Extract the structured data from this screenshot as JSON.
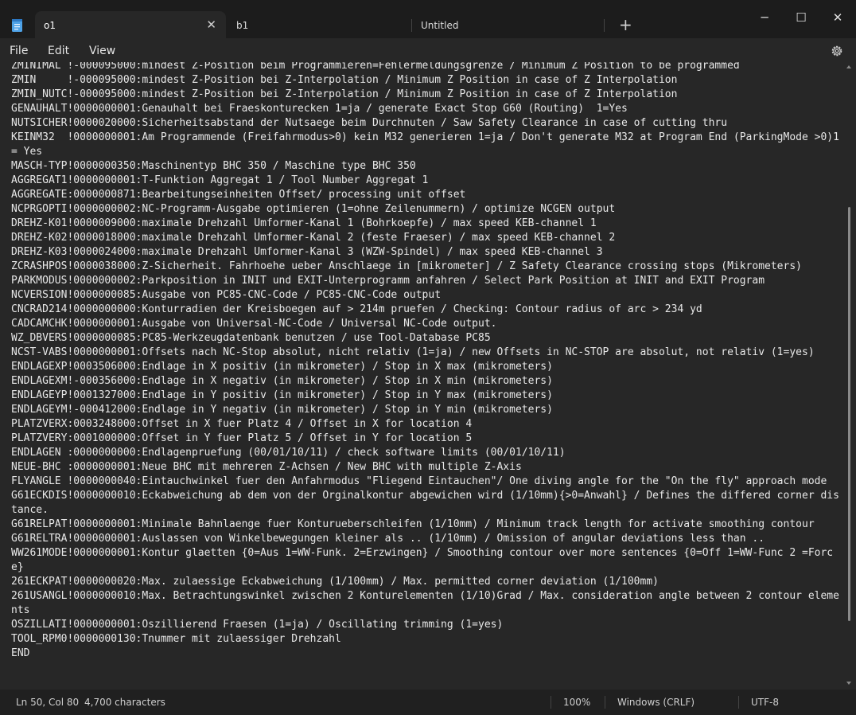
{
  "tabs": [
    {
      "label": "o1",
      "close": "✕"
    },
    {
      "label": "b1"
    },
    {
      "label": "Untitled"
    }
  ],
  "new_tab": "+",
  "window": {
    "minimize": "─",
    "maximize": "☐",
    "close": "✕"
  },
  "menu": {
    "file": "File",
    "edit": "Edit",
    "view": "View"
  },
  "lines": [
    "ZMINIMAL !-000095000:mindest Z-Position beim Programmieren=Fehlermeldungsgrenze / Minimum Z Position to be programmed",
    "ZMIN     !-000095000:mindest Z-Position bei Z-Interpolation / Minimum Z Position in case of Z Interpolation",
    "ZMIN_NUTC!-000095000:mindest Z-Position bei Z-Interpolation / Minimum Z Position in case of Z Interpolation",
    "GENAUHALT!0000000001:Genauhalt bei Fraeskonturecken 1=ja / generate Exact Stop G60 (Routing)  1=Yes",
    "NUTSICHER!0000020000:Sicherheitsabstand der Nutsaege beim Durchnuten / Saw Safety Clearance in case of cutting thru",
    "KEINM32  !0000000001:Am Programmende (Freifahrmodus>0) kein M32 generieren 1=ja / Don't generate M32 at Program End (ParkingMode >0)1= Yes",
    "MASCH-TYP!0000000350:Maschinentyp BHC 350 / Maschine type BHC 350",
    "AGGREGAT1!0000000001:T-Funktion Aggregat 1 / Tool Number Aggregat 1",
    "AGGREGATE:0000000871:Bearbeitungseinheiten Offset/ processing unit offset",
    "NCPRGOPTI!0000000002:NC-Programm-Ausgabe optimieren (1=ohne Zeilenummern) / optimize NCGEN output",
    "DREHZ-K01!0000009000:maximale Drehzahl Umformer-Kanal 1 (Bohrkoepfe) / max speed KEB-channel 1",
    "DREHZ-K02!0000018000:maximale Drehzahl Umformer-Kanal 2 (feste Fraeser) / max speed KEB-channel 2",
    "DREHZ-K03!0000024000:maximale Drehzahl Umformer-Kanal 3 (WZW-Spindel) / max speed KEB-channel 3",
    "ZCRASHPOS!0000038000:Z-Sicherheit. Fahrhoehe ueber Anschlaege in [mikrometer] / Z Safety Clearance crossing stops (Mikrometers)",
    "PARKMODUS!0000000002:Parkposition in INIT und EXIT-Unterprogramm anfahren / Select Park Position at INIT and EXIT Program",
    "NCVERSION!0000000085:Ausgabe von PC85-CNC-Code / PC85-CNC-Code output",
    "CNCRAD214!0000000000:Konturradien der Kreisboegen auf > 214m pruefen / Checking: Contour radius of arc > 234 yd",
    "CADCAMCHK!0000000001:Ausgabe von Universal-NC-Code / Universal NC-Code output.",
    "WZ_DBVERS!0000000085:PC85-Werkzeugdatenbank benutzen / use Tool-Database PC85",
    "NCST-VABS!0000000001:Offsets nach NC-Stop absolut, nicht relativ (1=ja) / new Offsets in NC-STOP are absolut, not relativ (1=yes)",
    "ENDLAGEXP!0003506000:Endlage in X positiv (in mikrometer) / Stop in X max (mikrometers)",
    "ENDLAGEXM!-000356000:Endlage in X negativ (in mikrometer) / Stop in X min (mikrometers)",
    "ENDLAGEYP!0001327000:Endlage in Y positiv (in mikrometer) / Stop in Y max (mikrometers)",
    "ENDLAGEYM!-000412000:Endlage in Y negativ (in mikrometer) / Stop in Y min (mikrometers)",
    "PLATZVERX:0003248000:Offset in X fuer Platz 4 / Offset in X for location 4",
    "PLATZVERY:0001000000:Offset in Y fuer Platz 5 / Offset in Y for location 5",
    "ENDLAGEN :0000000000:Endlagenpruefung (00/01/10/11) / check software limits (00/01/10/11)",
    "NEUE-BHC :0000000001:Neue BHC mit mehreren Z-Achsen / New BHC with multiple Z-Axis",
    "FLYANGLE !0000000040:Eintauchwinkel fuer den Anfahrmodus \"Fliegend Eintauchen\"/ One diving angle for the \"On the fly\" approach mode",
    "G61ECKDIS!0000000010:Eckabweichung ab dem von der Orginalkontur abgewichen wird (1/10mm){>0=Anwahl} / Defines the differed corner distance.",
    "G61RELPAT!0000000001:Minimale Bahnlaenge fuer Konturueberschleifen (1/10mm) / Minimum track length for activate smoothing contour",
    "G61RELTRA!0000000001:Auslassen von Winkelbewegungen kleiner als .. (1/10mm) / Omission of angular deviations less than ..",
    "WW261MODE!0000000001:Kontur glaetten {0=Aus 1=WW-Funk. 2=Erzwingen} / Smoothing contour over more sentences {0=Off 1=WW-Func 2 =Force}",
    "261ECKPAT!0000000020:Max. zulaessige Eckabweichung (1/100mm) / Max. permitted corner deviation (1/100mm)",
    "261USANGL!0000000010:Max. Betrachtungswinkel zwischen 2 Konturelementen (1/10)Grad / Max. consideration angle between 2 contour elements",
    "OSZILLATI!0000000001:Oszillierend Fraesen (1=ja) / Oscillating trimming (1=yes)",
    "TOOL_RPM0!0000000130:Tnummer mit zulaessiger Drehzahl",
    "END"
  ],
  "status": {
    "position": "Ln 50, Col 80",
    "characters": "4,700 characters",
    "zoom": "100%",
    "line_ending": "Windows (CRLF)",
    "encoding": "UTF-8"
  }
}
